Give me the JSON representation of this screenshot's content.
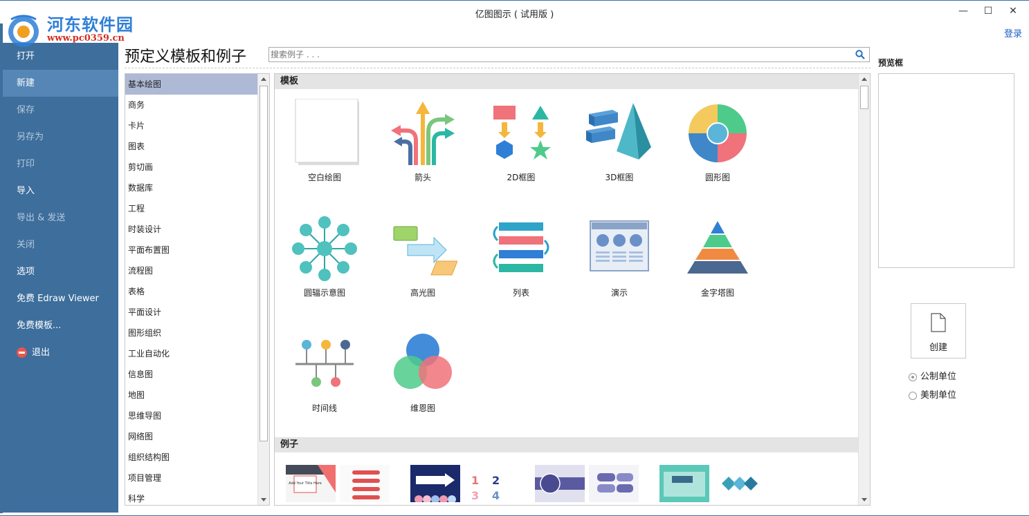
{
  "window": {
    "title": "亿图图示 ( 试用版 )",
    "minimize": "—",
    "maximize": "☐",
    "close": "✕",
    "login": "登录"
  },
  "watermark": {
    "site_name": "河东软件园",
    "site_url": "www.pc0359.cn"
  },
  "nav": {
    "items": [
      {
        "label": "打开",
        "state": "normal"
      },
      {
        "label": "新建",
        "state": "active"
      },
      {
        "label": "保存",
        "state": "disabled"
      },
      {
        "label": "另存为",
        "state": "disabled"
      },
      {
        "label": "打印",
        "state": "disabled"
      },
      {
        "label": "导入",
        "state": "normal"
      },
      {
        "label": "导出 & 发送",
        "state": "disabled"
      },
      {
        "label": "关闭",
        "state": "disabled"
      },
      {
        "label": "选项",
        "state": "normal"
      },
      {
        "label": "免费 Edraw Viewer",
        "state": "normal"
      },
      {
        "label": "免费模板...",
        "state": "normal"
      },
      {
        "label": "退出",
        "state": "normal",
        "icon": "exit-icon"
      }
    ]
  },
  "main": {
    "page_title": "预定义模板和例子",
    "search_placeholder": "搜索例子 . . ."
  },
  "categories": [
    "基本绘图",
    "商务",
    "卡片",
    "图表",
    "剪切画",
    "数据库",
    "工程",
    "时装设计",
    "平面布置图",
    "流程图",
    "表格",
    "平面设计",
    "图形组织",
    "工业自动化",
    "信息图",
    "地图",
    "思维导图",
    "网络图",
    "组织结构图",
    "项目管理",
    "科学"
  ],
  "selected_category": "基本绘图",
  "templates": {
    "section_title": "模板",
    "items": [
      {
        "label": "空白绘图",
        "icon": "blank-drawing-icon"
      },
      {
        "label": "箭头",
        "icon": "arrows-icon"
      },
      {
        "label": "2D框图",
        "icon": "2d-block-icon"
      },
      {
        "label": "3D框图",
        "icon": "3d-block-icon"
      },
      {
        "label": "圆形图",
        "icon": "circle-chart-icon"
      },
      {
        "label": "圆辐示意图",
        "icon": "radial-diagram-icon"
      },
      {
        "label": "高光图",
        "icon": "highlight-diagram-icon"
      },
      {
        "label": "列表",
        "icon": "list-icon"
      },
      {
        "label": "演示",
        "icon": "presentation-icon"
      },
      {
        "label": "金字塔图",
        "icon": "pyramid-icon"
      },
      {
        "label": "时间线",
        "icon": "timeline-icon"
      },
      {
        "label": "维恩图",
        "icon": "venn-icon"
      }
    ]
  },
  "examples": {
    "section_title": "例子",
    "thumb_text": "Add Your Title Here"
  },
  "right_panel": {
    "preview_label": "预览框",
    "create_label": "创建",
    "units": [
      {
        "label": "公制单位",
        "checked": true
      },
      {
        "label": "美制单位",
        "checked": false
      }
    ]
  },
  "colors": {
    "nav_bg": "#3d6e9c",
    "nav_active": "#5686b5",
    "selected_category": "#aeb9d6",
    "link": "#1a62c8"
  }
}
